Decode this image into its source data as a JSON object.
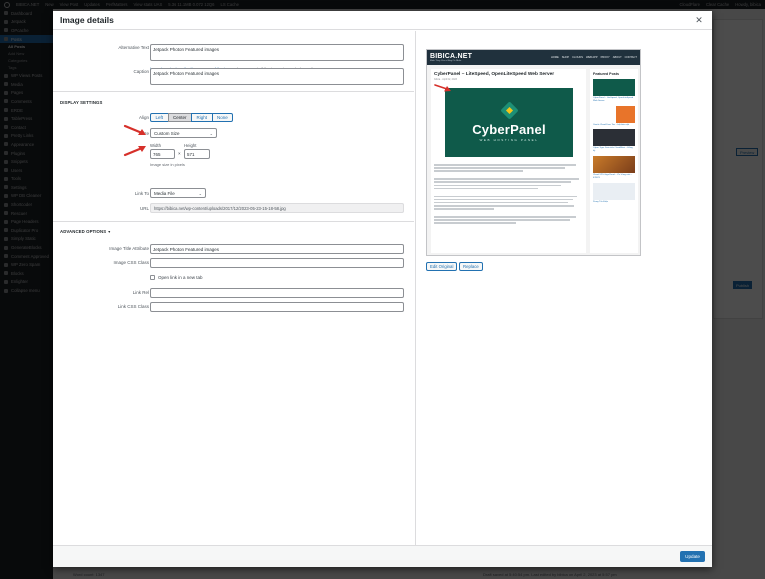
{
  "admin_bar": {
    "site": "BIBICA.NET",
    "new": "New",
    "items": [
      "View Post",
      "Updates",
      "PerfMatters",
      "View stats UAS",
      "5.3s  11.1MB  0.072  12Q6",
      "LS Cache"
    ],
    "right": [
      "CloudFlare",
      "Clear Cache",
      "Howdy, bibica"
    ]
  },
  "sidebar": {
    "items": [
      {
        "label": "Dashboard"
      },
      {
        "label": "Jetpack"
      },
      {
        "label": "OPcache"
      },
      {
        "label": "Posts",
        "active": true
      },
      {
        "label": "WP Views Posts"
      },
      {
        "label": "Media"
      },
      {
        "label": "Pages"
      },
      {
        "label": "Comments"
      },
      {
        "label": "ERDE"
      },
      {
        "label": "TablePress"
      },
      {
        "label": "Contact"
      },
      {
        "label": "Pretty Links"
      },
      {
        "label": "Appearance"
      },
      {
        "label": "Plugins"
      },
      {
        "label": "Snippets"
      },
      {
        "label": "Users"
      },
      {
        "label": "Tools"
      },
      {
        "label": "Settings"
      },
      {
        "label": "WP DB Cleaner"
      },
      {
        "label": "Shortcoder"
      },
      {
        "label": "Rescuer"
      },
      {
        "label": "Page Headers"
      },
      {
        "label": "Duplicator Pro"
      },
      {
        "label": "Simply Static"
      },
      {
        "label": "GenerateBlocks"
      },
      {
        "label": "Comment Approved"
      },
      {
        "label": "WP Zero Spam"
      },
      {
        "label": "Blocks"
      },
      {
        "label": "Enlighter"
      },
      {
        "label": "Collapse menu"
      }
    ],
    "subitems": [
      "All Posts",
      "Add New",
      "Categories",
      "Tags"
    ]
  },
  "background": {
    "side_texts": [
      "Preview",
      "Publish"
    ],
    "footer_left": "Word count: 1347",
    "footer_right": "Draft saved at 5:40:54 pm. Last edited by bibica on April 2, 2023 at 5:57 pm"
  },
  "modal": {
    "title": "Image details",
    "close_icon": "close-icon",
    "alt_label": "Alternative Text",
    "alt_value": "Jetpack Photon Featured images",
    "alt_hint_link": "Learn how to describe the purpose of the image",
    "alt_hint_rest": ". Leave empty if the image is purely decorative.",
    "caption_label": "Caption",
    "caption_value": "Jetpack Photon Featured images",
    "display_settings": "Display Settings",
    "align_label": "Align",
    "align_options": [
      "Left",
      "Center",
      "Right",
      "None"
    ],
    "align_selected": "Center",
    "size_label": "Size",
    "size_value": "Custom Size",
    "width_label": "Width",
    "height_label": "Height",
    "width_value": "765",
    "height_value": "571",
    "times": "×",
    "size_hint": "Image size in pixels",
    "link_to_label": "Link To",
    "link_to_value": "Media File",
    "url_label": "URL",
    "url_value": "https://bibica.net/wp-content/uploads/2017/12/2023-05-23-15-18-58.jpg",
    "advanced_options": "Advanced Options",
    "title_attr_label": "Image Title Attribute",
    "title_attr_value": "Jetpack Photon Featured images",
    "css_class_label": "Image CSS Class",
    "css_class_value": "",
    "new_tab_label": "Open link in a new tab",
    "link_rel_label": "Link Rel",
    "link_rel_value": "",
    "link_css_label": "Link CSS Class",
    "link_css_value": "",
    "edit_original": "Edit Original",
    "replace": "Replace",
    "update": "Update",
    "arrow_color": "#d6302a",
    "accent": "#2271b1"
  },
  "preview": {
    "site_logo": "BIBICA.NET",
    "site_tagline": "Mình Thủy Chủ ở Blog Cá Nhân",
    "menu": [
      "HOME",
      "SHOP",
      "CLOUDS",
      "WEB APP",
      "PROXY",
      "ABOUT",
      "CONTACT"
    ],
    "post_title": "CyberPanel – LiteSpeed, OpenLiteSpeed Web Server",
    "post_meta": "bibica · April 02, 2023",
    "brand": "CyberPanel",
    "brand_sub": "WEB HOSTING PANEL",
    "sidebar_title": "Featured Posts",
    "featured_captions": [
      "CyberPanel – LiteSpeed, OpenLiteSpeed Web Server",
      "Oracle Cloud Free Tier – bật bảo mật",
      "Cyber Tiger Data trên CloudBlast – Đăng ký",
      "Cloud VPS GigaCloud – Ưu Vùng mới – 4/2023",
      "Proxy Tốc Điện"
    ]
  }
}
